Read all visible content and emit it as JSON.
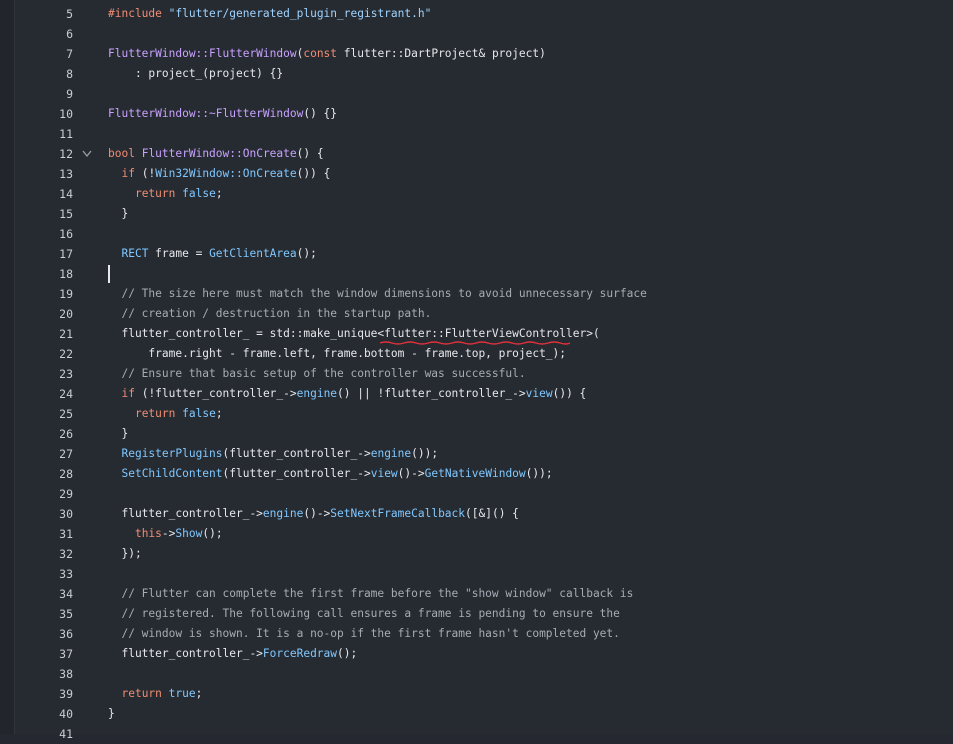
{
  "editor": {
    "lines": [
      {
        "n": "5",
        "code": "#include \"flutter/generated_plugin_registrant.h\""
      },
      {
        "n": "6",
        "code": ""
      },
      {
        "n": "7",
        "code": "FlutterWindow::FlutterWindow(const flutter::DartProject& project)"
      },
      {
        "n": "8",
        "code": "    : project_(project) {}"
      },
      {
        "n": "9",
        "code": ""
      },
      {
        "n": "10",
        "code": "FlutterWindow::~FlutterWindow() {}"
      },
      {
        "n": "11",
        "code": ""
      },
      {
        "n": "12",
        "code": "bool FlutterWindow::OnCreate() {"
      },
      {
        "n": "13",
        "code": "  if (!Win32Window::OnCreate()) {"
      },
      {
        "n": "14",
        "code": "    return false;"
      },
      {
        "n": "15",
        "code": "  }"
      },
      {
        "n": "16",
        "code": ""
      },
      {
        "n": "17",
        "code": "  RECT frame = GetClientArea();"
      },
      {
        "n": "18",
        "code": ""
      },
      {
        "n": "19",
        "code": "  // The size here must match the window dimensions to avoid unnecessary surface"
      },
      {
        "n": "20",
        "code": "  // creation / destruction in the startup path."
      },
      {
        "n": "21",
        "code": "  flutter_controller_ = std::make_unique<flutter::FlutterViewController>("
      },
      {
        "n": "22",
        "code": "      frame.right - frame.left, frame.bottom - frame.top, project_);"
      },
      {
        "n": "23",
        "code": "  // Ensure that basic setup of the controller was successful."
      },
      {
        "n": "24",
        "code": "  if (!flutter_controller_->engine() || !flutter_controller_->view()) {"
      },
      {
        "n": "25",
        "code": "    return false;"
      },
      {
        "n": "26",
        "code": "  }"
      },
      {
        "n": "27",
        "code": "  RegisterPlugins(flutter_controller_->engine());"
      },
      {
        "n": "28",
        "code": "  SetChildContent(flutter_controller_->view()->GetNativeWindow());"
      },
      {
        "n": "29",
        "code": ""
      },
      {
        "n": "30",
        "code": "  flutter_controller_->engine()->SetNextFrameCallback([&]() {"
      },
      {
        "n": "31",
        "code": "    this->Show();"
      },
      {
        "n": "32",
        "code": "  });"
      },
      {
        "n": "33",
        "code": ""
      },
      {
        "n": "34",
        "code": "  // Flutter can complete the first frame before the \"show window\" callback is"
      },
      {
        "n": "35",
        "code": "  // registered. The following call ensures a frame is pending to ensure the"
      },
      {
        "n": "36",
        "code": "  // window is shown. It is a no-op if the first frame hasn't completed yet."
      },
      {
        "n": "37",
        "code": "  flutter_controller_->ForceRedraw();"
      },
      {
        "n": "38",
        "code": ""
      },
      {
        "n": "39",
        "code": "  return true;"
      },
      {
        "n": "40",
        "code": "}"
      },
      {
        "n": "41",
        "code": ""
      }
    ],
    "fold_line": "12",
    "caret_line": "18",
    "squiggle_text": "flutter::FlutterViewController"
  },
  "colors": {
    "background": "#262a31",
    "keyword": "#f08d73",
    "string": "#9fd3ff",
    "function": "#c8a2ff",
    "call": "#80c8ff",
    "comment": "#a6acb5",
    "squiggle": "#e0323b"
  },
  "icons": {
    "fold": "chevron-down-icon"
  }
}
